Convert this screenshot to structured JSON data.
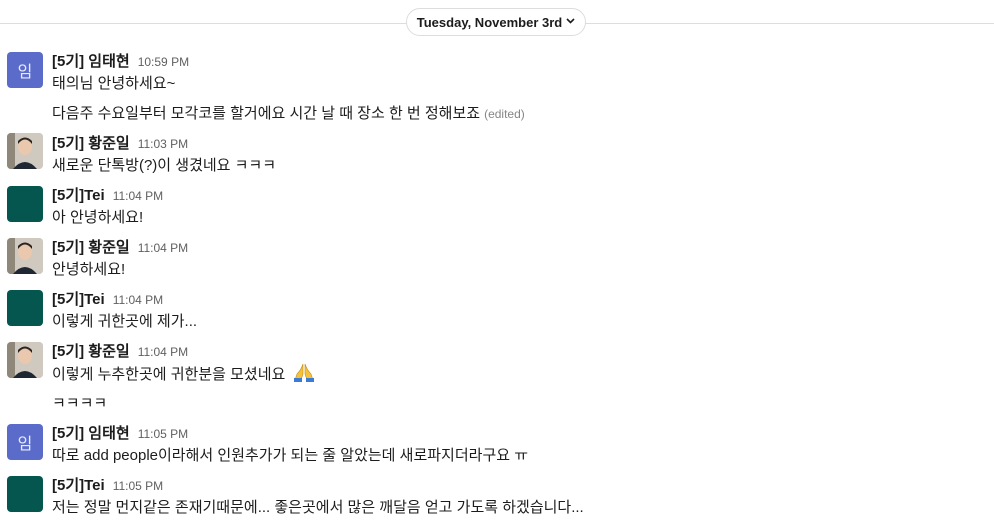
{
  "date_divider": {
    "label": "Tuesday, November 3rd",
    "chevron_icon": "chevron-down-icon"
  },
  "colors": {
    "avatar_purple": "#5b6bc9",
    "avatar_teal": "#04564f",
    "time_gray": "#616061"
  },
  "messages": [
    {
      "author": "[5기] 임태현",
      "time": "10:59 PM",
      "avatar": "purple",
      "avatar_text": "임",
      "lines": [
        "태의님 안녕하세요~",
        "다음주 수요일부터 모각코를 할거에요 시간 날 때 장소 한 번 정해보죠"
      ],
      "edited_label": "(edited)"
    },
    {
      "author": "[5기] 황준일",
      "time": "11:03 PM",
      "avatar": "photo",
      "lines": [
        "새로운 단톡방(?)이 생겼네요 ㅋㅋㅋ"
      ]
    },
    {
      "author": "[5기]Tei",
      "time": "11:04 PM",
      "avatar": "teal",
      "lines": [
        "아 안녕하세요!"
      ]
    },
    {
      "author": "[5기] 황준일",
      "time": "11:04 PM",
      "avatar": "photo",
      "lines": [
        "안녕하세요!"
      ]
    },
    {
      "author": "[5기]Tei",
      "time": "11:04 PM",
      "avatar": "teal",
      "lines": [
        "이렇게 귀한곳에 제가..."
      ]
    },
    {
      "author": "[5기] 황준일",
      "time": "11:04 PM",
      "avatar": "photo",
      "lines": [
        "이렇게 누추한곳에 귀한분을 모셨네요",
        "ㅋㅋㅋㅋ"
      ],
      "emoji": "folded-hands-emoji"
    },
    {
      "author": "[5기] 임태현",
      "time": "11:05 PM",
      "avatar": "purple",
      "avatar_text": "임",
      "lines": [
        "따로 add people이라해서 인원추가가 되는 줄 알았는데 새로파지더라구요 ㅠ"
      ]
    },
    {
      "author": "[5기]Tei",
      "time": "11:05 PM",
      "avatar": "teal",
      "lines": [
        "저는 정말 먼지같은 존재기때문에... 좋은곳에서 많은 깨달음 얻고 가도록 하겠습니다..."
      ]
    }
  ]
}
